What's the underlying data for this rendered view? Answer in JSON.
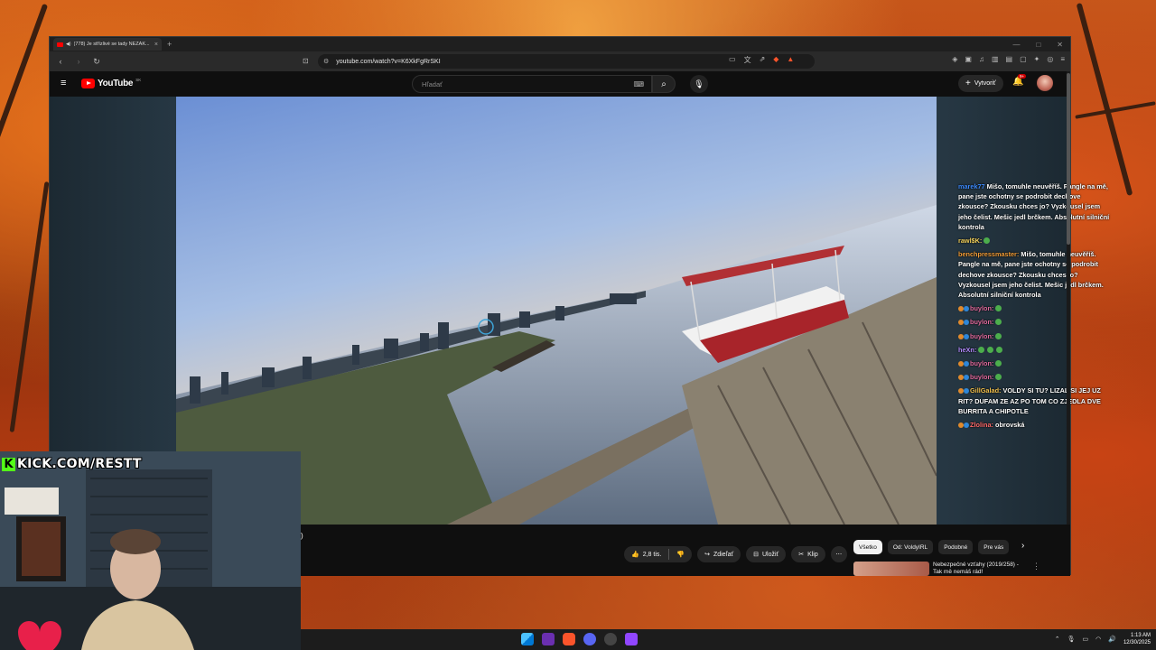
{
  "browser": {
    "tab_title": "(778) Je střízlivé se tady NEZAK...",
    "url": "youtube.com/watch?v=K6XkFgRrSKI",
    "theme_accent": "#ff0000"
  },
  "youtube": {
    "logo_text": "YouTube",
    "country_code": "SK",
    "search_placeholder": "Hľadať",
    "create_label": "Vytvoriť",
    "notification_count": "9+"
  },
  "chat": [
    {
      "user": "marek77",
      "user_color": "#3d8bfd",
      "text": "Mišo, tomuhle neuvěříš. Pangle na mě, pane jste ochotny se podrobit dechove zkousce? Zkousku chces jo? Vyzkousel jsem jeho čelist. Mešic jedl brčkem. Absolutní silniční kontrola",
      "badges": 0
    },
    {
      "user": "rawl$K:",
      "user_color": "#f4d35e",
      "text": "",
      "badges": 0,
      "emotes": 1
    },
    {
      "user": "benchpressmaster:",
      "user_color": "#f29d38",
      "text": "Mišo, tomuhle neuvěříš. Pangle na mě, pane jste ochotny se podrobit dechove zkousce? Zkousku chces jo? Vyzkousel jsem jeho čelist. Mešic jedl brčkem. Absolutní silniční kontrola",
      "badges": 0
    },
    {
      "user": "buylon:",
      "user_color": "#e06c9f",
      "text": "",
      "badges": 2,
      "emotes": 1
    },
    {
      "user": "buylon:",
      "user_color": "#e06c9f",
      "text": "",
      "badges": 2,
      "emotes": 1
    },
    {
      "user": "buylon:",
      "user_color": "#e06c9f",
      "text": "",
      "badges": 2,
      "emotes": 1
    },
    {
      "user": "heXn:",
      "user_color": "#b48cff",
      "text": "",
      "badges": 0,
      "emotes": 3
    },
    {
      "user": "buylon:",
      "user_color": "#e06c9f",
      "text": "",
      "badges": 2,
      "emotes": 1
    },
    {
      "user": "buylon:",
      "user_color": "#e06c9f",
      "text": "",
      "badges": 2,
      "emotes": 1
    },
    {
      "user": "GillGalad:",
      "user_color": "#f2c14e",
      "text": "VOLDY SI TU? LIZAL SI JEJ UZ RIT? DUFAM ZE AZ PO TOM CO ZJEDLA DVE BURRITA A CHIPOTLE",
      "badges": 2
    },
    {
      "user": "Zlolina:",
      "user_color": "#ff6b6b",
      "text": "obrovská",
      "badges": 2
    }
  ],
  "below_video": {
    "partial_title": ")",
    "like_count": "2,8 tis.",
    "share_label": "Zdieľať",
    "save_label": "Uložiť",
    "clip_label": "Klip",
    "chips": [
      "Všetko",
      "Od: VoldyIRL",
      "Podobné",
      "Pre vás"
    ],
    "rec_title": "Nebezpečné vzťahy (2019/258) - Tak mě nemáš rád!"
  },
  "overlay": {
    "kick_text": "KICK.COM/RESTT"
  },
  "taskbar": {
    "time": "1:13 AM",
    "date": "12/30/2025"
  }
}
